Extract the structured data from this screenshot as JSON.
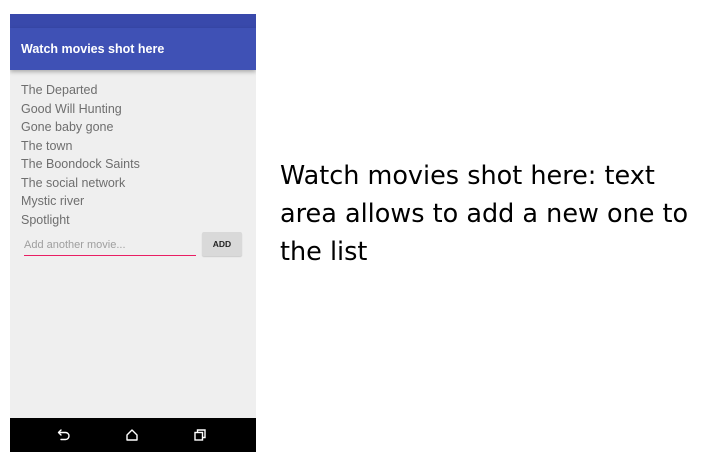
{
  "app": {
    "title": "Watch movies shot here",
    "colors": {
      "status_bar": "#3949ab",
      "app_bar": "#3f51b5",
      "accent": "#e91e63",
      "background": "#efefef",
      "nav_bar": "#000000"
    }
  },
  "movies": [
    "The Departed",
    "Good Will Hunting",
    "Gone baby gone",
    "The town",
    "The Boondock Saints",
    "The social network",
    "Mystic river",
    "Spotlight"
  ],
  "add_form": {
    "placeholder": "Add another movie...",
    "value": "",
    "button_label": "ADD"
  },
  "nav": {
    "icons": [
      "back-icon",
      "home-icon",
      "recents-icon"
    ]
  },
  "caption": "Watch movies shot here: text area allows to add a new one to the list"
}
